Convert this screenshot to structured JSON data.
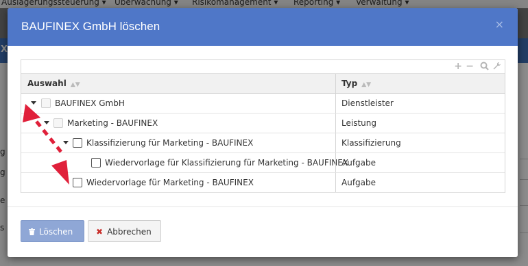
{
  "background": {
    "nav_items": [
      "Auslagerungssteuerung ▾",
      "Überwachung ▾",
      "Risikomanagement ▾",
      "Reporting ▾",
      "Verwaltung ▾"
    ],
    "band_text": "X",
    "side_letters": [
      "g",
      "g",
      "e",
      "s"
    ]
  },
  "modal": {
    "title": "BAUFINEX GmbH löschen",
    "close_icon": "×"
  },
  "toolbar": {
    "add_icon": "+",
    "remove_icon": "−",
    "search_icon": "search",
    "settings_icon": "wrench"
  },
  "grid": {
    "columns": {
      "auswahl": "Auswahl",
      "typ": "Typ"
    },
    "rows": [
      {
        "label": "BAUFINEX GmbH",
        "typ": "Dienstleister",
        "expanded": true,
        "enabled": false
      },
      {
        "label": "Marketing - BAUFINEX",
        "typ": "Leistung",
        "expanded": true,
        "enabled": false
      },
      {
        "label": "Klassifizierung für Marketing - BAUFINEX",
        "typ": "Klassifizierung",
        "expanded": true,
        "enabled": true
      },
      {
        "label": "Wiedervorlage für Klassifizierung für Marketing - BAUFINEX",
        "typ": "Aufgabe",
        "expanded": false,
        "enabled": true
      },
      {
        "label": "Wiedervorlage für Marketing - BAUFINEX",
        "typ": "Aufgabe",
        "expanded": false,
        "enabled": true
      }
    ]
  },
  "footer": {
    "delete_label": "Löschen",
    "cancel_label": "Abbrechen",
    "delete_icon": "trash-icon",
    "cancel_icon": "✖"
  },
  "colors": {
    "header": "#4f77c8",
    "delete_button": "#8fa7d6",
    "annotation_arrow": "#e0203a"
  }
}
